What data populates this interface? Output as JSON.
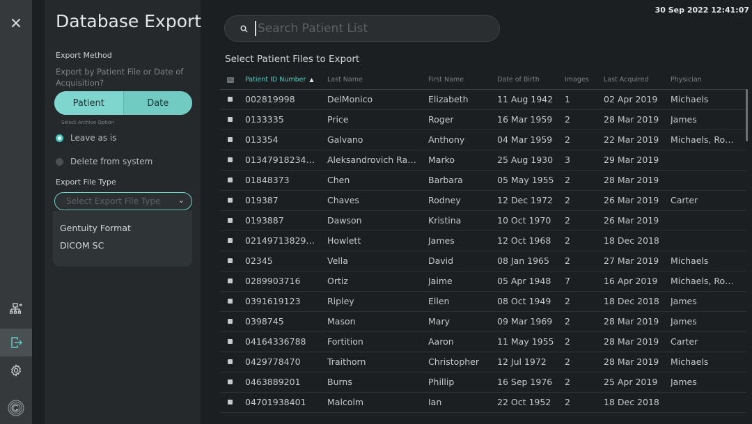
{
  "app": {
    "title": "Database Export",
    "datetime": "30 Sep 2022  12:41:07"
  },
  "rail": {
    "close_glyph": "×",
    "icons": [
      "close-icon",
      "network-export-icon",
      "export-icon",
      "settings-gear-icon",
      "gentuity-logo-icon"
    ],
    "active": "export-icon"
  },
  "sidebar": {
    "export_method_label": "Export Method",
    "export_method_hint": "Export by Patient File or Date of Acquisition?",
    "segments": [
      "Patient",
      "Date"
    ],
    "selected_segment": "Patient",
    "archive_label": "Select Archive Option",
    "archive_options": [
      "Leave as is",
      "Delete from system"
    ],
    "archive_selected": "Leave as is",
    "file_type_label": "Export File Type",
    "file_type_placeholder": "Select Export File Type",
    "file_type_options": [
      "Gentuity Format",
      "DICOM SC"
    ]
  },
  "search": {
    "placeholder": "Search Patient List"
  },
  "list": {
    "title": "Select Patient Files to Export",
    "select_all_label": "ALL",
    "columns": [
      "Patient ID Number",
      "Last Name",
      "First Name",
      "Date of Birth",
      "Images",
      "Last Acquired",
      "Physician"
    ],
    "sorted_column": "Patient ID Number",
    "rows": [
      [
        "002819998",
        "DelMonico",
        "Elizabeth",
        "11 Aug 1942",
        "1",
        "02 Apr 2019",
        "Michaels"
      ],
      [
        "0133335",
        "Price",
        "Roger",
        "16 Mar 1959",
        "2",
        "28 Mar 2019",
        "James"
      ],
      [
        "013354",
        "Galvano",
        "Anthony",
        "04 Mar 1959",
        "2",
        "22 Mar 2019",
        "Michaels, Ro…"
      ],
      [
        "01347918234…",
        "Aleksandrovich Ra…",
        "Marko",
        "25 Aug 1930",
        "3",
        "29 Mar 2019",
        ""
      ],
      [
        "01848373",
        "Chen",
        "Barbara",
        "05 May 1955",
        "2",
        "28 Mar 2019",
        ""
      ],
      [
        "019387",
        "Chaves",
        "Rodney",
        "12 Dec 1972",
        "2",
        "26 Mar 2019",
        "Carter"
      ],
      [
        "0193887",
        "Dawson",
        "Kristina",
        "10 Oct 1970",
        "2",
        "26 Mar 2019",
        ""
      ],
      [
        "02149713829…",
        "Howlett",
        "James",
        "12 Oct 1968",
        "2",
        "18 Dec 2018",
        ""
      ],
      [
        "02345",
        "Vella",
        "David",
        "08 Jan 1965",
        "2",
        "27 Mar 2019",
        "Michaels"
      ],
      [
        "0289903716",
        "Ortiz",
        "Jaime",
        "05 Apr 1948",
        "7",
        "16 Apr 2019",
        "Michaels, Ro…"
      ],
      [
        "0391619123",
        "Ripley",
        "Ellen",
        "08 Oct 1949",
        "2",
        "18 Dec 2018",
        "James"
      ],
      [
        "0398745",
        "Mason",
        "Mary",
        "09 Mar 1969",
        "2",
        "28 Mar 2019",
        "James"
      ],
      [
        "04164336788",
        "Fortition",
        "Aaron",
        "11 May 1955",
        "2",
        "28 Mar 2019",
        "Carter"
      ],
      [
        "0429778470",
        "Traithorn",
        "Christopher",
        "12 Jul 1972",
        "2",
        "28 Mar 2019",
        "Michaels"
      ],
      [
        "0463889201",
        "Burns",
        "Phillip",
        "16 Sep 1976",
        "2",
        "25 Apr 2019",
        "James"
      ],
      [
        "04701938401",
        "Malcolm",
        "Ian",
        "22 Oct 1952",
        "2",
        "18 Dec 2018",
        ""
      ]
    ]
  }
}
